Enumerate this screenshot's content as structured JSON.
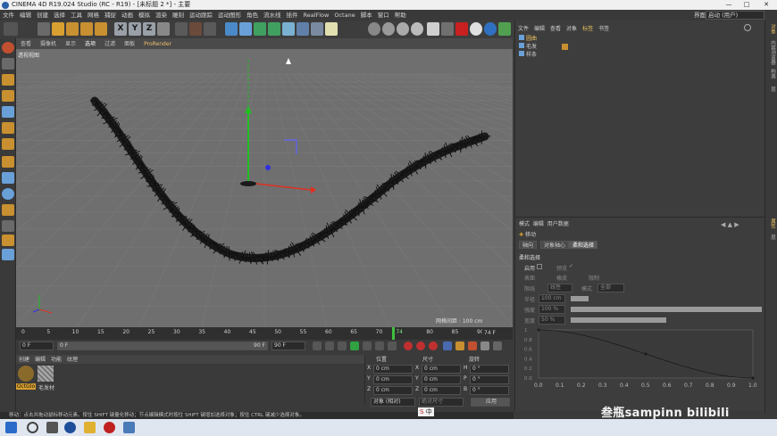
{
  "window": {
    "title": "CINEMA 4D R19.024 Studio (RC - R19) - [未标题 2 *] - 主要",
    "minimize": "—",
    "maximize": "□",
    "close": "✕"
  },
  "menubar": {
    "items": [
      "文件",
      "编辑",
      "创建",
      "选择",
      "工具",
      "网格",
      "捕捉",
      "动画",
      "模拟",
      "渲染",
      "雕刻",
      "运动跟踪",
      "运动图形",
      "角色",
      "流水线",
      "插件",
      "RealFlow",
      "Octane",
      "脚本",
      "窗口",
      "帮助"
    ],
    "layout_label": "界面:",
    "layout_value": "启动 (用户)"
  },
  "toolbar": {
    "xyz": [
      "X",
      "Y",
      "Z"
    ]
  },
  "viewport": {
    "menu": [
      "查看",
      "摄像机",
      "显示",
      "选项",
      "过滤",
      "面板",
      "ProRender"
    ],
    "active_menu": "选项",
    "label": "透视视图",
    "grid_spacing": "网格间距 : 100 cm"
  },
  "timeline": {
    "ticks": [
      "0",
      "5",
      "10",
      "15",
      "20",
      "25",
      "30",
      "35",
      "40",
      "45",
      "50",
      "55",
      "60",
      "65",
      "70",
      "74",
      "80",
      "85",
      "90"
    ],
    "current_frame": "74",
    "end_frame": "74 F"
  },
  "transport": {
    "start": "0 F",
    "range_start": "0 F",
    "range_end": "90 F",
    "end": "90 F"
  },
  "material_manager": {
    "menu": [
      "创建",
      "编辑",
      "功能",
      "纹理"
    ],
    "materials": [
      "OctGlo",
      "毛发材"
    ]
  },
  "coordinates": {
    "headers": [
      "位置",
      "尺寸",
      "旋转"
    ],
    "rows": [
      {
        "axis": "X",
        "pos": "0 cm",
        "size": "0 cm",
        "rot_axis": "H",
        "rot": "0 °"
      },
      {
        "axis": "Y",
        "pos": "0 cm",
        "size": "0 cm",
        "rot_axis": "P",
        "rot": "0 °"
      },
      {
        "axis": "Z",
        "pos": "0 cm",
        "size": "0 cm",
        "rot_axis": "B",
        "rot": "0 °"
      }
    ],
    "mode": "对象 (相对)",
    "size_mode": "绝对尺寸",
    "apply": "应用"
  },
  "status_bar": "移动：点击并拖动鼠标移动元素。按住 SHIFT 键量化移动；节点编辑模式时按住 SHIFT 键增加选择对象；按住 CTRL 键减少选择对象。",
  "object_manager": {
    "menu": [
      "文件",
      "编辑",
      "查看",
      "对象",
      "标签",
      "书签"
    ],
    "active_menu": "标签",
    "objects": [
      "圆曲",
      "毛发",
      "样条"
    ]
  },
  "attribute_manager": {
    "menu": [
      "模式",
      "编辑",
      "用户数据"
    ],
    "tool": "移动",
    "tabs": [
      "轴向",
      "对象轴心",
      "柔和选择"
    ],
    "active_tab": "柔和选择",
    "section": "柔和选择",
    "enable": "启用",
    "preview": "预览",
    "surface": "表面",
    "rubber": "橡皮",
    "restrict": "限制",
    "mode_label": "限线",
    "mode_value": "线性",
    "mode2_label": "模式",
    "mode2_value": "全部",
    "radius_label": "半径",
    "radius_value": "100 cm",
    "strength_label": "强度",
    "strength_value": "100 %",
    "strength_fill": 1.0,
    "width_label": "宽度",
    "width_value": "50 %",
    "width_fill": 0.5,
    "graph_x_ticks": [
      "0.0",
      "0.1",
      "0.2",
      "0.3",
      "0.4",
      "0.5",
      "0.6",
      "0.7",
      "0.8",
      "0.9",
      "1.0"
    ],
    "graph_y_ticks": [
      "1",
      "0.8",
      "0.6",
      "0.4",
      "0.2",
      "0.0"
    ]
  },
  "right_strip": [
    "对象",
    "内容浏览器",
    "构造",
    "层"
  ],
  "right_strip2": [
    "属性",
    "层"
  ],
  "watermark": "叁瓶sampinn  bilibili",
  "taskbar": {
    "ime": "中"
  }
}
